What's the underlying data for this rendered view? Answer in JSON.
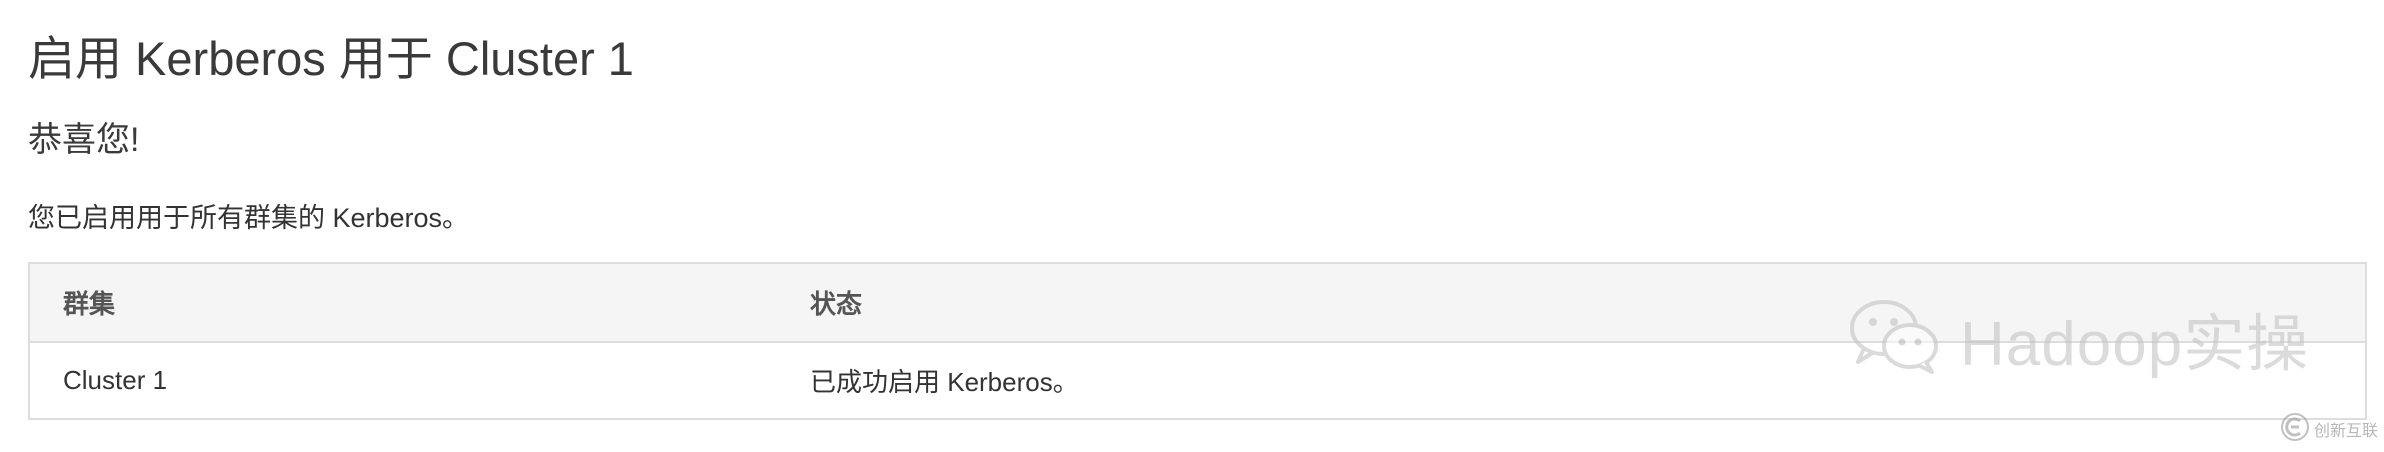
{
  "page": {
    "title": "启用 Kerberos 用于 Cluster 1",
    "congrats": "恭喜您!",
    "message": "您已启用用于所有群集的 Kerberos。"
  },
  "table": {
    "columns": [
      "群集",
      "状态"
    ],
    "rows": [
      {
        "cluster": "Cluster 1",
        "status": "已成功启用 Kerberos。"
      }
    ]
  },
  "watermark": {
    "icon": "wechat-icon",
    "text": "Hadoop实操"
  },
  "corner_logo": {
    "icon": "brand-logo-icon",
    "text": "创新互联"
  }
}
